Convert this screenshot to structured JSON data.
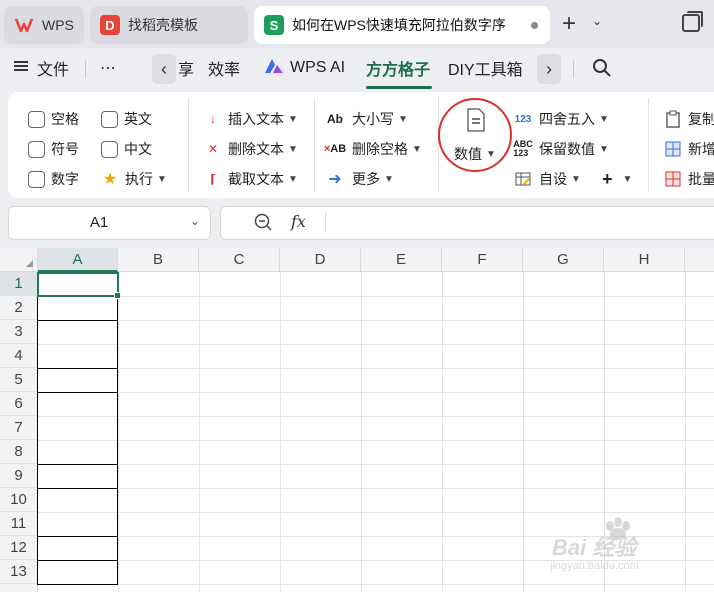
{
  "tabs": [
    {
      "label": "WPS",
      "icon": "wps-logo-icon",
      "color": "#e7453a"
    },
    {
      "label": "找稻壳模板",
      "icon": "docer-logo-icon",
      "color": "#e7453a"
    },
    {
      "label": "如何在WPS快速填充阿拉伯数字序",
      "icon": "spreadsheet-s-icon",
      "color": "#1e9e5a"
    }
  ],
  "menu": {
    "file": "文件",
    "more": "⋯",
    "share_partial": "享",
    "efficiency": "效率",
    "wps_ai": "WPS AI",
    "fangfang": "方方格子",
    "diy": "DIY工具箱"
  },
  "ribbon": {
    "checkboxes": [
      "空格",
      "英文",
      "符号",
      "中文",
      "数字"
    ],
    "execute": "执行",
    "text_tools": [
      "插入文本",
      "删除文本",
      "截取文本"
    ],
    "case": "大小写",
    "delete_spaces": "删除空格",
    "more": "更多",
    "numeric": "数值",
    "round": "四舍五入",
    "keep_value": "保留数值",
    "custom": "自设",
    "copy": "复制",
    "add": "新增",
    "batch": "批量"
  },
  "formula_bar": {
    "cell_ref": "A1",
    "fx": "fx"
  },
  "sheet": {
    "columns": [
      "A",
      "B",
      "C",
      "D",
      "E",
      "F",
      "G",
      "H"
    ],
    "rows": [
      "1",
      "2",
      "3",
      "4",
      "5",
      "6",
      "7",
      "8",
      "9",
      "10",
      "11",
      "12",
      "13"
    ]
  },
  "watermark": {
    "text": "Bai 经验",
    "url": "jingyan.baidu.com"
  },
  "colors": {
    "accent_green": "#1e7a4f",
    "annotation_red": "#d9302c"
  }
}
